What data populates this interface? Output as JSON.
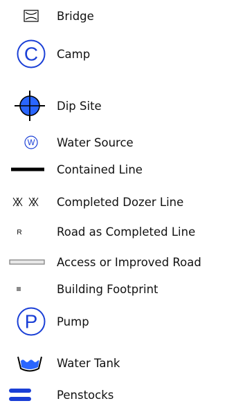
{
  "legend": {
    "items": [
      {
        "label": "Bridge",
        "icon": "bridge-icon"
      },
      {
        "label": "Camp",
        "icon": "camp-icon"
      },
      {
        "label": "Dip Site",
        "icon": "dip-site-icon"
      },
      {
        "label": "Water Source",
        "icon": "water-source-icon"
      },
      {
        "label": "Contained Line",
        "icon": "contained-line-icon"
      },
      {
        "label": "Completed Dozer Line",
        "icon": "completed-dozer-line-icon"
      },
      {
        "label": "Road as Completed Line",
        "icon": "road-as-completed-line-icon"
      },
      {
        "label": "Access or Improved Road",
        "icon": "access-or-improved-road-icon"
      },
      {
        "label": "Building Footprint",
        "icon": "building-footprint-icon"
      },
      {
        "label": "Pump",
        "icon": "pump-icon"
      },
      {
        "label": "Water Tank",
        "icon": "water-tank-icon"
      },
      {
        "label": "Penstocks",
        "icon": "penstocks-icon"
      }
    ],
    "symbol_text": {
      "camp": "C",
      "water_source": "W",
      "road": "R",
      "pump": "P"
    },
    "colors": {
      "blue": "#1a3fd6",
      "fill_blue": "#2a66ff",
      "black": "#000000",
      "gray": "#8a8a8a",
      "light_gray": "#e8e8e8"
    }
  }
}
